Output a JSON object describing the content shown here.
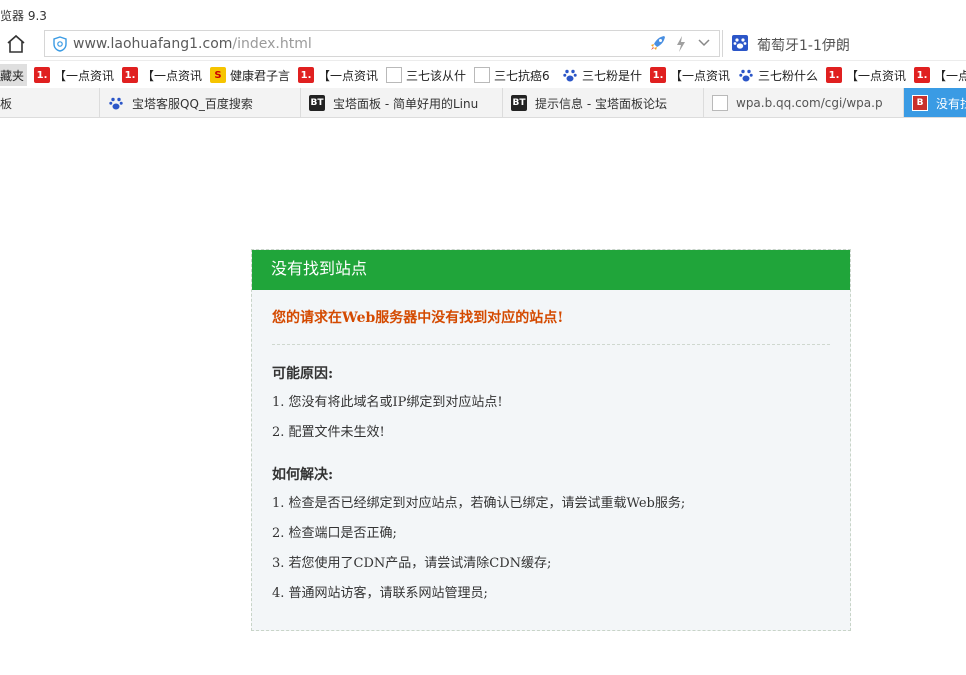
{
  "window": {
    "title": "览器 9.3"
  },
  "address": {
    "url_host": "www.laohuafang1.com",
    "url_path": "/index.html"
  },
  "search": {
    "text": "葡萄牙1-1伊朗"
  },
  "bookmarks": [
    {
      "label": "藏夹",
      "icon": "folder-icon"
    },
    {
      "label": "【一点资讯",
      "icon": "yidian-icon"
    },
    {
      "label": "【一点资讯",
      "icon": "yidian-icon"
    },
    {
      "label": "健康君子言",
      "icon": "sohu-icon"
    },
    {
      "label": "【一点资讯",
      "icon": "yidian-icon"
    },
    {
      "label": "三七该从什",
      "icon": "page-icon"
    },
    {
      "label": "三七抗癌6",
      "icon": "page-icon"
    },
    {
      "label": "三七粉是什",
      "icon": "baidu-paw-icon"
    },
    {
      "label": "【一点资讯",
      "icon": "yidian-icon"
    },
    {
      "label": "三七粉什么",
      "icon": "baidu-paw-icon"
    },
    {
      "label": "【一点资讯",
      "icon": "yidian-icon"
    },
    {
      "label": "【一点",
      "icon": "yidian-icon"
    }
  ],
  "tabs": [
    {
      "label": "板",
      "icon": ""
    },
    {
      "label": "宝塔客服QQ_百度搜索",
      "icon": "baidu-paw-icon"
    },
    {
      "label": "宝塔面板 - 简单好用的Linu",
      "icon": "bt-icon"
    },
    {
      "label": "提示信息 - 宝塔面板论坛",
      "icon": "bt-icon"
    },
    {
      "label": "wpa.b.qq.com/cgi/wpa.p",
      "icon": "page-icon"
    },
    {
      "label": "没有找",
      "icon": "bt-red-icon"
    }
  ],
  "card": {
    "header": "没有找到站点",
    "error": "您的请求在Web服务器中没有找到对应的站点!",
    "reasons_title": "可能原因:",
    "reasons": [
      "1. 您没有将此域名或IP绑定到对应站点!",
      "2. 配置文件未生效!"
    ],
    "solutions_title": "如何解决:",
    "solutions": [
      "1. 检查是否已经绑定到对应站点，若确认已绑定，请尝试重载Web服务;",
      "2. 检查端口是否正确;",
      "3. 若您使用了CDN产品，请尝试清除CDN缓存;",
      "4. 普通网站访客，请联系网站管理员;"
    ]
  },
  "colors": {
    "header_green": "#20a53a",
    "error_orange": "#d44a00",
    "active_tab_blue": "#3a9be4"
  }
}
